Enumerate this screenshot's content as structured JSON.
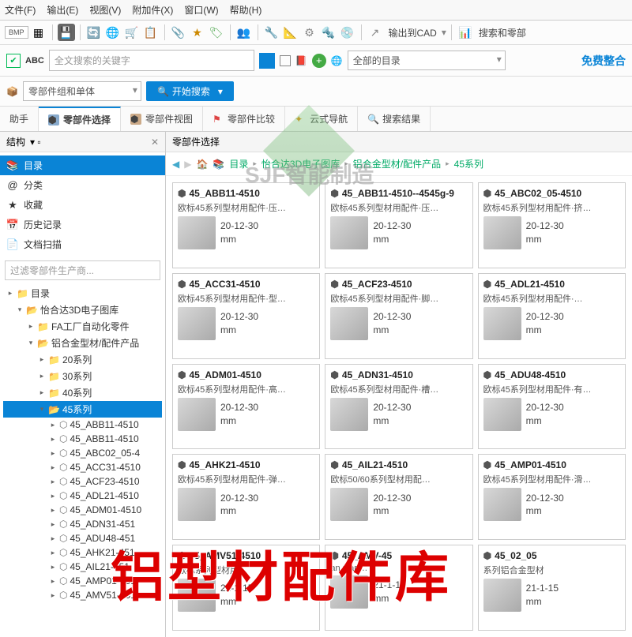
{
  "menu": [
    "文件(F)",
    "输出(E)",
    "视图(V)",
    "附加件(X)",
    "窗口(W)",
    "帮助(H)"
  ],
  "toolbar": {
    "bmp": "BMP",
    "cad": "输出到CAD",
    "search": "搜索和零部"
  },
  "searchbar": {
    "abc": "ABC",
    "placeholder": "全文搜索的关键字",
    "catalog": "全部的目录",
    "freelink": "免费整合"
  },
  "searchbar2": {
    "scope": "零部件组和单体",
    "btn": "开始搜索"
  },
  "tabs": [
    "助手",
    "零部件选择",
    "零部件视图",
    "零部件比较",
    "云式导航",
    "搜索结果"
  ],
  "tabs_active": 1,
  "side": {
    "title": "结构",
    "nav": [
      {
        "icon": "📚",
        "label": "目录",
        "sel": true
      },
      {
        "icon": "@",
        "label": "分类"
      },
      {
        "icon": "★",
        "label": "收藏"
      },
      {
        "icon": "📅",
        "label": "历史记录"
      },
      {
        "icon": "📄",
        "label": "文档扫描"
      }
    ],
    "filter": "过滤零部件生产商...",
    "tree_root": "目录",
    "tree_lib": "怡合达3D电子图库",
    "tree_fa": "FA工厂自动化零件",
    "tree_al": "铝合金型材/配件产品",
    "series": [
      "20系列",
      "30系列",
      "40系列"
    ],
    "series_sel": "45系列",
    "parts": [
      "45_ABB11-4510",
      "45_ABB11-4510",
      "45_ABC02_05-4",
      "45_ACC31-4510",
      "45_ACF23-4510",
      "45_ADL21-4510",
      "45_ADM01-4510",
      "45_ADN31-451",
      "45_ADU48-451",
      "45_AHK21-451",
      "45_AIL21-451",
      "45_AMP01-451",
      "45_AMV51-451"
    ]
  },
  "main": {
    "title": "零部件选择",
    "crumb": [
      "目录",
      "怡合达3D电子图库",
      "铝合金型材/配件产品",
      "45系列"
    ]
  },
  "cards": [
    {
      "t": "45_ABB11-4510",
      "d": "欧标45系列型材用配件·压…",
      "dim": "20-12-30",
      "u": "mm"
    },
    {
      "t": "45_ABB11-4510--4545g-9",
      "d": "欧标45系列型材用配件·压…",
      "dim": "20-12-30",
      "u": "mm"
    },
    {
      "t": "45_ABC02_05-4510",
      "d": "欧标45系列型材用配件·挤…",
      "dim": "20-12-30",
      "u": "mm"
    },
    {
      "t": "45_ACC31-4510",
      "d": "欧标45系列型材用配件·型…",
      "dim": "20-12-30",
      "u": "mm"
    },
    {
      "t": "45_ACF23-4510",
      "d": "欧标45系列型材用配件·脚…",
      "dim": "20-12-30",
      "u": "mm"
    },
    {
      "t": "45_ADL21-4510",
      "d": "欧标45系列型材用配件·…",
      "dim": "20-12-30",
      "u": "mm"
    },
    {
      "t": "45_ADM01-4510",
      "d": "欧标45系列型材用配件·高…",
      "dim": "20-12-30",
      "u": "mm"
    },
    {
      "t": "45_ADN31-4510",
      "d": "欧标45系列型材用配件·槽…",
      "dim": "20-12-30",
      "u": "mm"
    },
    {
      "t": "45_ADU48-4510",
      "d": "欧标45系列型材用配件·有…",
      "dim": "20-12-30",
      "u": "mm"
    },
    {
      "t": "45_AHK21-4510",
      "d": "欧标45系列型材用配件·弹…",
      "dim": "20-12-30",
      "u": "mm"
    },
    {
      "t": "45_AIL21-4510",
      "d": "欧标50/60系列型材用配…",
      "dim": "20-12-30",
      "u": "mm"
    },
    {
      "t": "45_AMP01-4510",
      "d": "欧标45系列型材用配件·滑…",
      "dim": "20-12-30",
      "u": "mm"
    },
    {
      "t": "45_AMV51-4510",
      "d": "欧标系列型材用…",
      "dim": "21-1-15",
      "u": "mm"
    },
    {
      "t": "45_AMV-45",
      "d": "an stan…",
      "dim": "21-1-15",
      "u": "mm"
    },
    {
      "t": "45_02_05",
      "d": "系列铝合金型材",
      "dim": "21-1-15",
      "u": "mm"
    }
  ],
  "overlay": "铝型材配件库",
  "watermark": "SJF智能制造"
}
